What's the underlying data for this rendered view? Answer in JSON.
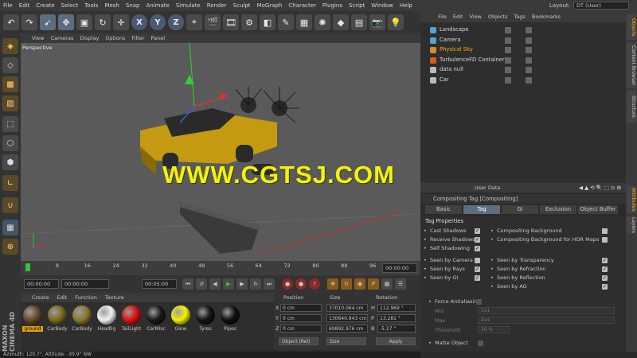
{
  "menubar": [
    "File",
    "Edit",
    "Create",
    "Select",
    "Tools",
    "Mesh",
    "Snap",
    "Animate",
    "Simulate",
    "Render",
    "Sculpt",
    "MoGraph",
    "Character",
    "Plugins",
    "Script",
    "Window",
    "Help"
  ],
  "layout": {
    "label": "Layout:",
    "value": "DT (User)"
  },
  "toolbar": {
    "x": "X",
    "y": "Y",
    "z": "Z"
  },
  "viewport": {
    "menu": [
      "View",
      "Cameras",
      "Display",
      "Options",
      "Filter",
      "Panel"
    ],
    "label": "Perspective",
    "watermark": "WWW.CGTSJ.COM"
  },
  "timeline": {
    "ticks": [
      "0",
      "8",
      "16",
      "24",
      "32",
      "40",
      "48",
      "56",
      "64",
      "72",
      "80",
      "88",
      "96"
    ],
    "end_label": "00:00:00"
  },
  "transport": {
    "start": "00:00:00",
    "current": "00:00:00",
    "end": "00:05:00"
  },
  "material_manager": {
    "menu": [
      "Create",
      "Edit",
      "Function",
      "Texture"
    ],
    "materials": [
      {
        "name": "ground",
        "color": "#6a4a2a",
        "active": true
      },
      {
        "name": "CarBody",
        "color": "#7a6a20"
      },
      {
        "name": "CarBody",
        "color": "#8a7a30"
      },
      {
        "name": "Headlig",
        "color": "#f2f2f2"
      },
      {
        "name": "TailLight",
        "color": "#e01010"
      },
      {
        "name": "CarMisc",
        "color": "#1a1a1a"
      },
      {
        "name": "Glow",
        "color": "#f2f200"
      },
      {
        "name": "Tyres",
        "color": "#141414"
      },
      {
        "name": "Pipes",
        "color": "#101010"
      }
    ]
  },
  "coordinates": {
    "headers": {
      "position": "Position",
      "size": "Size",
      "rotation": "Rotation"
    },
    "rows": [
      {
        "axis": "X",
        "pos": "0 cm",
        "size": "37010.064 cm",
        "rot_axis": "H",
        "rot": "112.969 °"
      },
      {
        "axis": "Y",
        "pos": "0 cm",
        "size": "130640.943 cm",
        "rot_axis": "P",
        "rot": "13.281 °"
      },
      {
        "axis": "Z",
        "pos": "0 cm",
        "size": "69892.976 cm",
        "rot_axis": "B",
        "rot": "-5.27 °"
      }
    ],
    "mode": "Object (Rel)",
    "size_mode": "Size",
    "apply": "Apply"
  },
  "status": "Azimuth: 120.7°, Altitude: -30.9°  NW",
  "object_manager": {
    "menu": [
      "File",
      "Edit",
      "View",
      "Objects",
      "Tags",
      "Bookmarks"
    ],
    "objects": [
      {
        "name": "Landscape",
        "icon_color": "#5aa0d0"
      },
      {
        "name": "Camera",
        "icon_color": "#5aa0d0"
      },
      {
        "name": "Physical Sky",
        "icon_color": "#d09030",
        "highlight": true
      },
      {
        "name": "TurbulenceFD Container",
        "icon_color": "#d06020"
      },
      {
        "name": "data null",
        "icon_color": "#bbbbbb"
      },
      {
        "name": "Car",
        "icon_color": "#bbbbbb"
      }
    ]
  },
  "side_tabs": [
    "Objects",
    "Content Browser",
    "Structure",
    "Attributes",
    "Layers"
  ],
  "attributes": {
    "menu_label": "User Data",
    "title": "Compositing Tag [Compositing]",
    "tabs": [
      "Basic",
      "Tag",
      "GI",
      "Exclusion",
      "Object Buffer"
    ],
    "section": "Tag Properties",
    "left_checks": [
      {
        "label": "Cast Shadows",
        "checked": true
      },
      {
        "label": "Receive Shadows",
        "checked": true
      },
      {
        "label": "Self Shadowing",
        "checked": true
      }
    ],
    "right_checks": [
      {
        "label": "Compositing Background",
        "checked": false
      },
      {
        "label": "Compositing Background for HDR Maps",
        "checked": false
      }
    ],
    "left_checks2": [
      {
        "label": "Seen by Camera",
        "checked": false
      },
      {
        "label": "Seen by Rays",
        "checked": true
      },
      {
        "label": "Seen by GI",
        "checked": true
      }
    ],
    "right_checks2": [
      {
        "label": "Seen by Transparency",
        "checked": true
      },
      {
        "label": "Seen by Refraction",
        "checked": true
      },
      {
        "label": "Seen by Reflection",
        "checked": true
      },
      {
        "label": "Seen by AO",
        "checked": true
      }
    ],
    "force_aa": "Force Antialiasing",
    "min_label": "Min",
    "min_value": "1x1",
    "max_label": "Max",
    "max_value": "4x4",
    "threshold_label": "Threshold",
    "threshold_value": "10 %",
    "matte": "Matte Object"
  },
  "colors": {
    "accent": "#ffb000",
    "watermark": "#f2f20a",
    "axis_x": "#e03030",
    "axis_y": "#30c030",
    "axis_z": "#3060e0"
  }
}
